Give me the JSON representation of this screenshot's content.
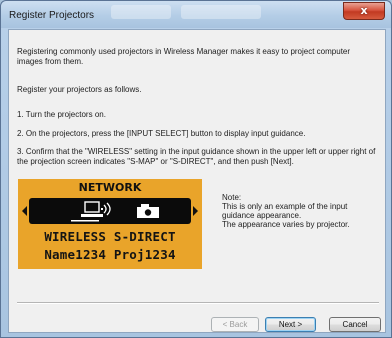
{
  "window": {
    "title": "Register Projectors",
    "close_label": "x"
  },
  "intro": "Registering commonly used projectors in Wireless Manager makes it easy to project computer images from them.",
  "instructions_heading": "Register your projectors as follows.",
  "steps": [
    "1. Turn the projectors on.",
    "2. On the projectors, press the [INPUT SELECT] button to display input guidance.",
    "3. Confirm that the \"WIRELESS\" setting in the input guidance shown in the upper left or upper right of the projection screen indicates \"S-MAP\" or \"S-DIRECT\", and then push [Next]."
  ],
  "guidance_display": {
    "heading": "NETWORK",
    "mode_line": "WIRELESS S-DIRECT",
    "name_line": "Name1234 Proj1234",
    "background_color": "#e9a42a",
    "icons": [
      "computer-icon",
      "wireless-signal-icon",
      "projector-icon"
    ]
  },
  "note": {
    "label": "Note:",
    "line1": "This is only an example of the input guidance appearance.",
    "line2": "The appearance varies by projector."
  },
  "buttons": {
    "back": "< Back",
    "next": "Next >",
    "cancel": "Cancel"
  }
}
